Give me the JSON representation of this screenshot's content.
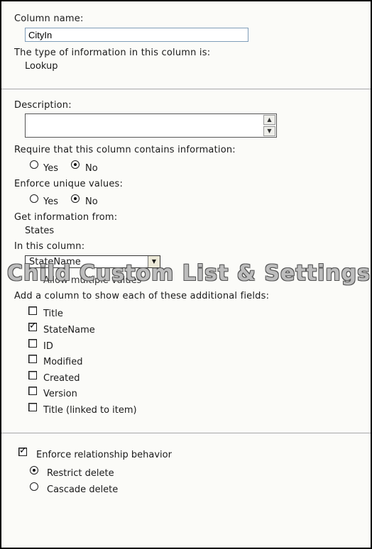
{
  "column_name": {
    "label": "Column name:",
    "value": "CityIn"
  },
  "info_type": {
    "label": "The type of information in this column is:",
    "value": "Lookup"
  },
  "description": {
    "label": "Description:"
  },
  "require": {
    "label": "Require that this column contains information:",
    "yes": "Yes",
    "no": "No",
    "selected": "No"
  },
  "unique": {
    "label": "Enforce unique values:",
    "yes": "Yes",
    "no": "No",
    "selected": "No"
  },
  "get_info": {
    "label": "Get information from:",
    "value": "States"
  },
  "in_column": {
    "label": "In this column:",
    "selected": "StateName",
    "allow_multiple": "Allow multiple values"
  },
  "watermark": "Child Custom List & Settings",
  "additional": {
    "label": "Add a column to show each of these additional fields:",
    "fields": [
      {
        "label": "Title",
        "checked": false
      },
      {
        "label": "StateName",
        "checked": true
      },
      {
        "label": "ID",
        "checked": false
      },
      {
        "label": "Modified",
        "checked": false
      },
      {
        "label": "Created",
        "checked": false
      },
      {
        "label": "Version",
        "checked": false
      },
      {
        "label": "Title (linked to item)",
        "checked": false
      }
    ]
  },
  "relationship": {
    "label": "Enforce relationship behavior",
    "checked": true,
    "options": [
      {
        "label": "Restrict delete",
        "selected": true
      },
      {
        "label": "Cascade delete",
        "selected": false
      }
    ]
  },
  "icons": {
    "check": "check-icon",
    "scroll_up": "arrow-up-icon",
    "scroll_down": "arrow-down-icon",
    "dropdown": "chevron-down-icon"
  }
}
